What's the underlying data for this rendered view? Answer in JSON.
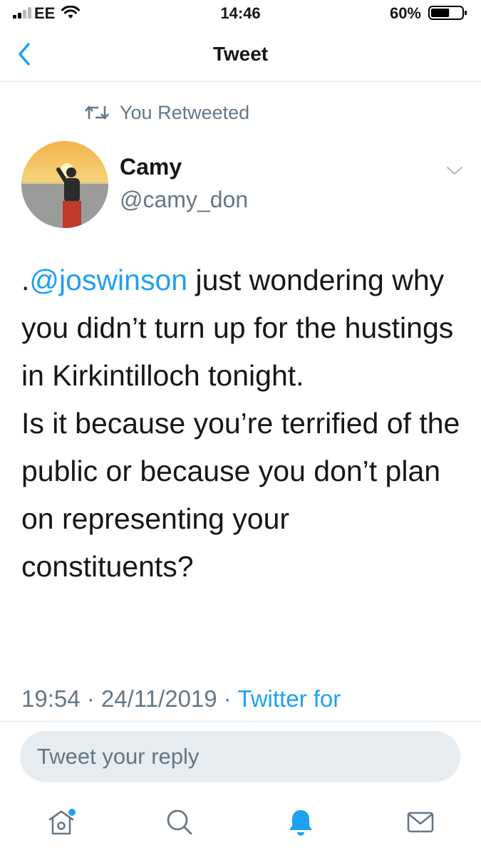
{
  "status_bar": {
    "carrier": "EE",
    "time": "14:46",
    "battery_percent": "60%",
    "battery_level": 0.6,
    "icons": [
      "cellular-signal-icon",
      "wifi-icon",
      "battery-icon"
    ]
  },
  "nav": {
    "back_icon": "chevron-left-icon",
    "title": "Tweet"
  },
  "retweet": {
    "icon": "retweet-icon",
    "label": "You Retweeted"
  },
  "tweet": {
    "author_name": "Camy",
    "author_handle": "@camy_don",
    "menu_icon": "chevron-down-icon",
    "text_prefix": ".",
    "mention": "@joswinson",
    "text_line1_rest": " just wondering why you didn’t turn up for the hustings in Kirkintilloch tonight.",
    "text_line2": "Is it because you’re terrified of the public or because you don’t plan on representing your constituents?",
    "time": "19:54",
    "date": "24/11/2019",
    "separator": " · ",
    "source": "Twitter for"
  },
  "reply": {
    "placeholder": "Tweet your reply"
  },
  "tab_bar": {
    "tabs": [
      {
        "icon": "home-icon",
        "active": false,
        "has_notification_dot": true
      },
      {
        "icon": "search-icon",
        "active": false
      },
      {
        "icon": "notifications-bell-icon",
        "active": true
      },
      {
        "icon": "messages-envelope-icon",
        "active": false
      }
    ]
  },
  "colors": {
    "accent": "#1da1f2",
    "secondary_text": "#657786",
    "primary_text": "#14171a",
    "reply_field_bg": "#e6ecf0",
    "divider": "#e1e8ed"
  }
}
